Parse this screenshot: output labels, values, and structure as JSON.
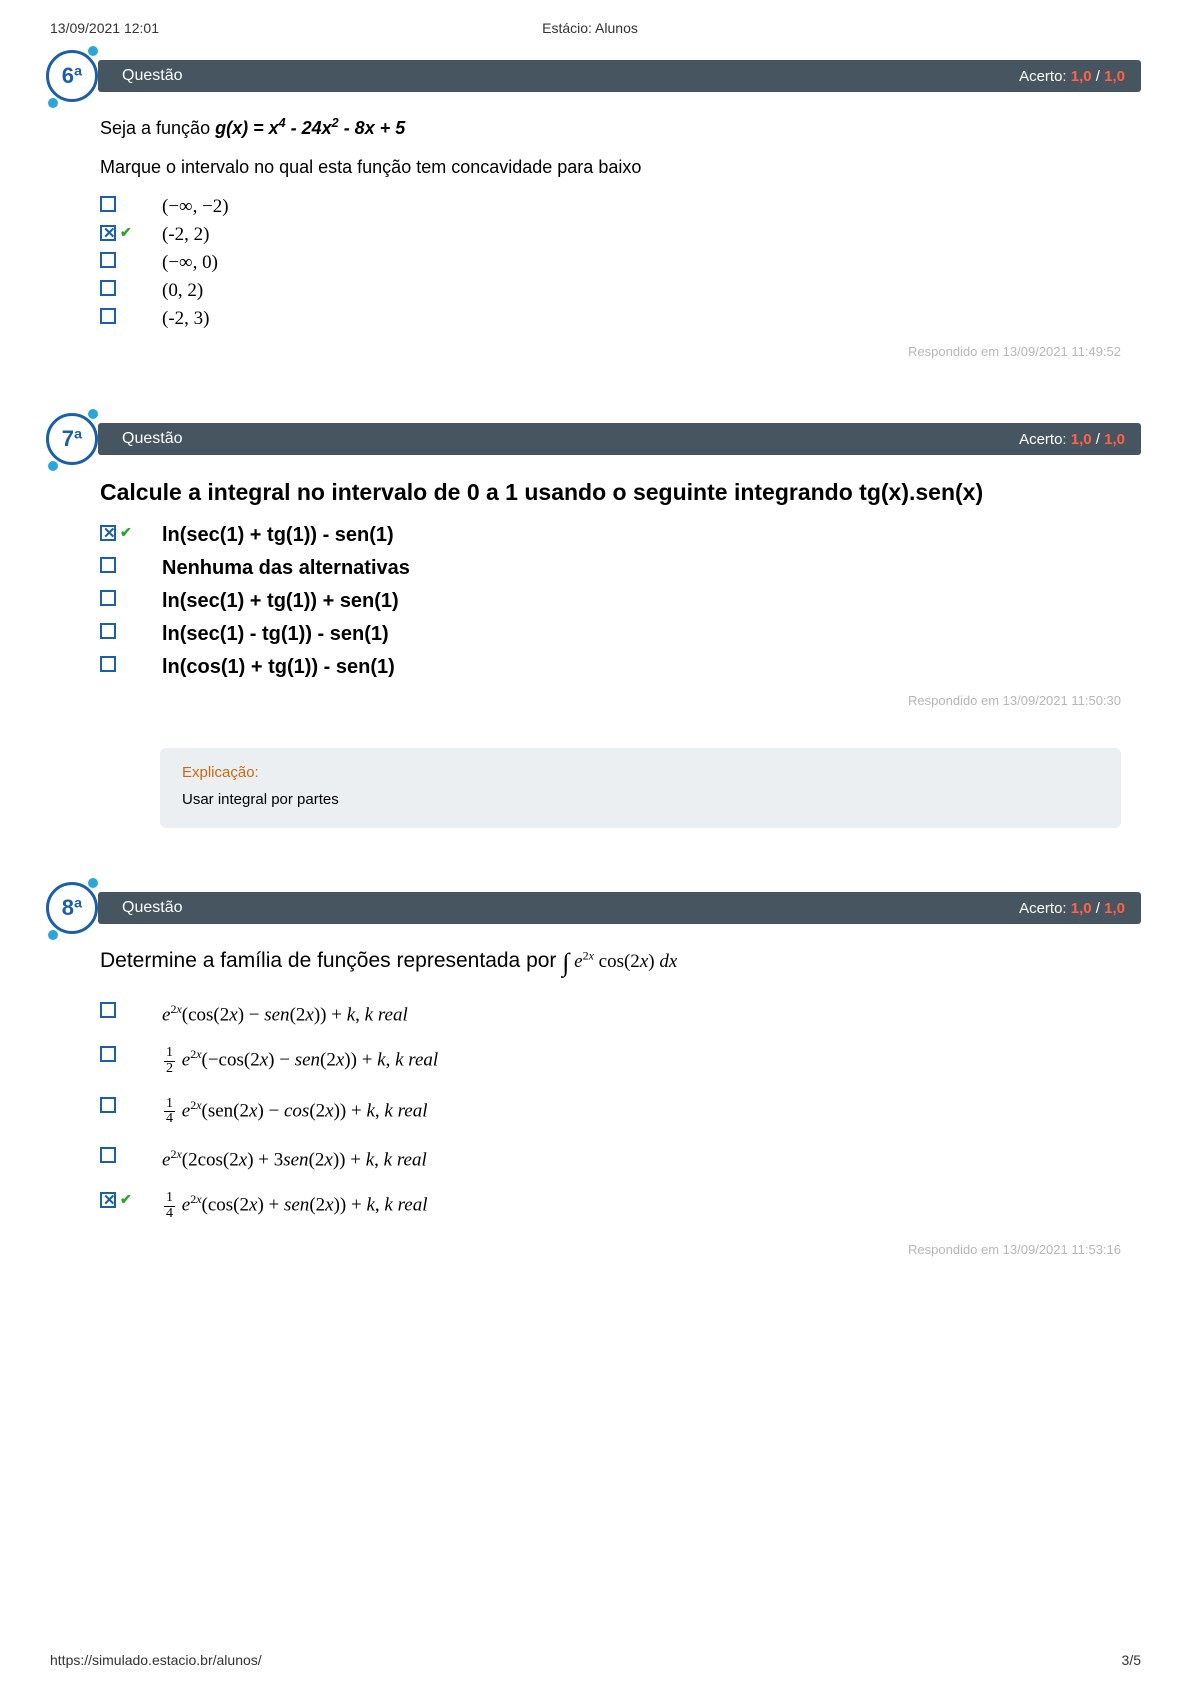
{
  "meta": {
    "timestamp": "13/09/2021 12:01",
    "title": "Estácio: Alunos",
    "url": "https://simulado.estacio.br/alunos/",
    "page": "3/5"
  },
  "score": {
    "label": "Acerto:",
    "earned": "1,0",
    "sep": "/",
    "total": "1,0"
  },
  "q6": {
    "num": "6ª",
    "bar": "Questão",
    "prompt_a": "Seja a função ",
    "prompt_fn": "g(x) = x⁴ - 24x² - 8x + 5",
    "prompt_b": "Marque o intervalo no qual esta função tem concavidade para baixo",
    "opts": [
      "(−∞, −2)",
      "(-2, 2)",
      "(−∞, 0)",
      "(0, 2)",
      "(-2, 3)"
    ],
    "selected": 1,
    "responded": "Respondido em 13/09/2021 11:49:52"
  },
  "q7": {
    "num": "7ª",
    "bar": "Questão",
    "prompt": "Calcule a integral no intervalo de 0 a 1 usando o seguinte integrando tg(x).sen(x)",
    "opts": [
      "ln(sec(1) + tg(1)) - sen(1)",
      "Nenhuma das alternativas",
      "ln(sec(1) + tg(1)) + sen(1)",
      "ln(sec(1) - tg(1)) - sen(1)",
      "ln(cos(1) + tg(1)) - sen(1)"
    ],
    "selected": 0,
    "responded": "Respondido em 13/09/2021 11:50:30",
    "explain_title": "Explicação:",
    "explain_body": "Usar integral por partes"
  },
  "q8": {
    "num": "8ª",
    "bar": "Questão",
    "prompt_a": "Determine a família de funções representada por ",
    "opts_math": [
      {
        "pre": "",
        "frac": "",
        "body": "e^{2x}(cos(2x) − sen(2x)) + k, k real"
      },
      {
        "frac": "1/2",
        "body": "e^{2x}(−cos(2x) − sen(2x)) + k, k real"
      },
      {
        "frac": "1/4",
        "body": "e^{2x}(sen(2x) − cos(2x)) + k, k real"
      },
      {
        "pre": "",
        "frac": "",
        "body": "e^{2x}(2cos(2x) + 3sen(2x)) + k, k real"
      },
      {
        "frac": "1/4",
        "body": "e^{2x}(cos(2x) + sen(2x)) + k, k real"
      }
    ],
    "selected": 4,
    "responded": "Respondido em 13/09/2021 11:53:16"
  }
}
